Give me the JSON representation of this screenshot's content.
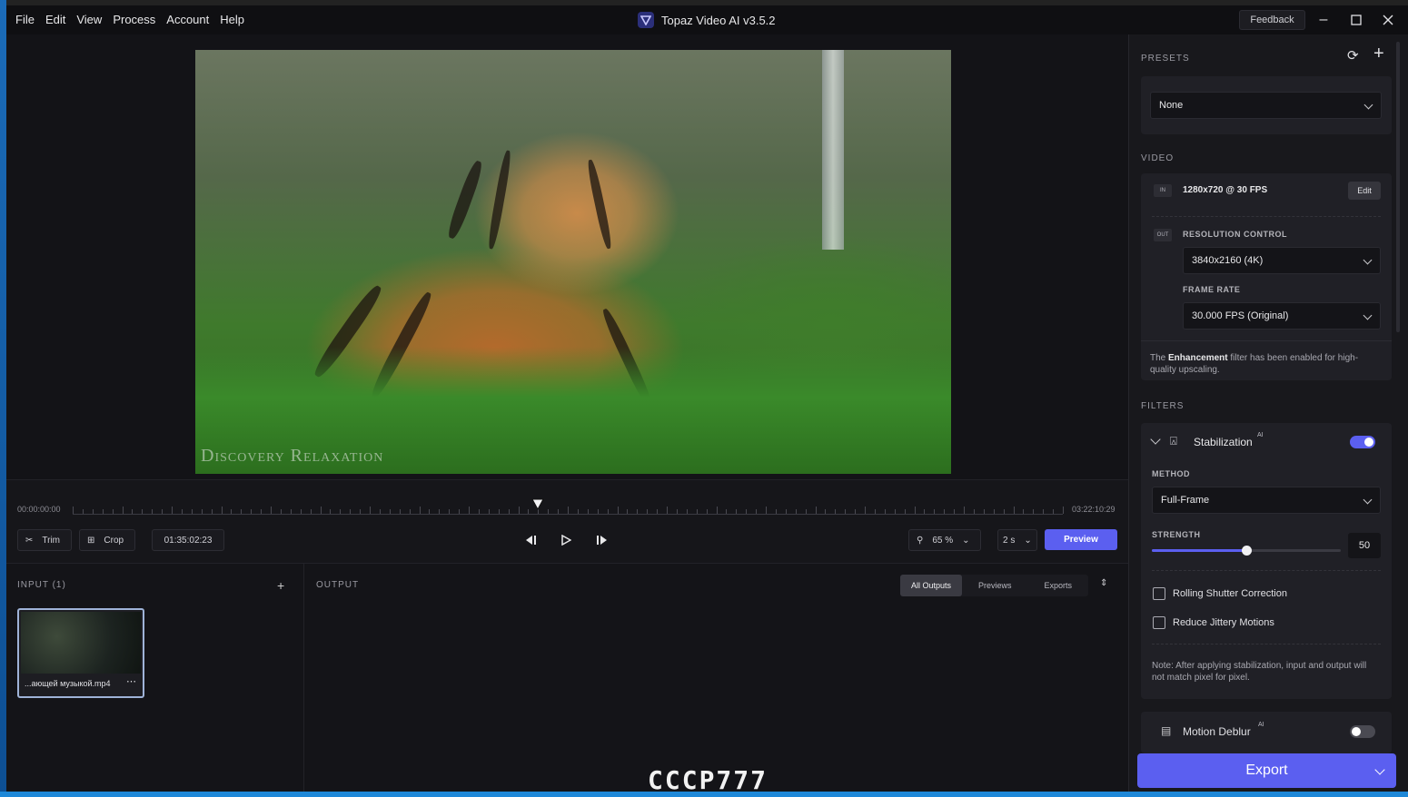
{
  "menu": [
    "File",
    "Edit",
    "View",
    "Process",
    "Account",
    "Help"
  ],
  "app": {
    "title": "Topaz Video AI  v3.5.2",
    "feedback": "Feedback"
  },
  "viewer": {
    "watermark": "Discovery Relaxation"
  },
  "timeline": {
    "start": "00:00:00:00",
    "end": "03:22:10:29",
    "trim": "Trim",
    "crop": "Crop",
    "current_time": "01:35:02:23",
    "zoom": "65 %",
    "step": "2 s",
    "preview": "Preview"
  },
  "input": {
    "label": "INPUT (1)",
    "file": "...ающей музыкой.mp4"
  },
  "output": {
    "label": "OUTPUT",
    "tabs": [
      "All Outputs",
      "Previews",
      "Exports"
    ],
    "logo_text": "CCCP777"
  },
  "right": {
    "presets_label": "PRESETS",
    "preset_value": "None",
    "video_label": "VIDEO",
    "in_badge": "IN",
    "in_resolution": "1280x720 @ 30 FPS",
    "edit": "Edit",
    "out_badge": "OUT",
    "resolution_control": "RESOLUTION CONTROL",
    "resolution_value": "3840x2160 (4K)",
    "frame_rate_label": "FRAME RATE",
    "frame_rate_value": "30.000 FPS (Original)",
    "enh_note_pre": "The ",
    "enh_note_bold": "Enhancement",
    "enh_note_post": " filter has been enabled for high-quality upscaling.",
    "filters_label": "FILTERS",
    "stabilization": "Stabilization",
    "ai_sup": "AI",
    "method_label": "METHOD",
    "method_value": "Full-Frame",
    "strength_label": "STRENGTH",
    "strength_value": "50",
    "strength_fraction": 0.5,
    "rolling": "Rolling Shutter Correction",
    "jittery": "Reduce Jittery Motions",
    "stab_note": "Note: After applying stabilization, input and output will not match pixel for pixel.",
    "motion_deblur": "Motion Deblur",
    "export": "Export"
  },
  "colors": {
    "accent": "#5b5ff0"
  }
}
